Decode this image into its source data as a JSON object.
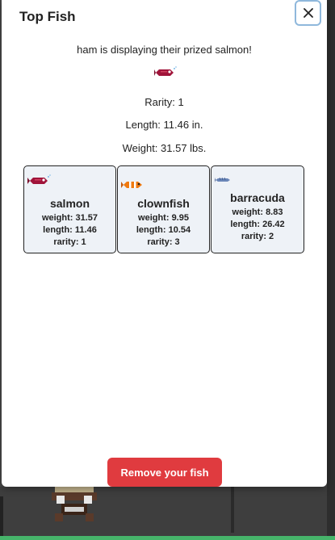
{
  "modal": {
    "title": "Top Fish",
    "close_label": "×",
    "message": "ham is displaying their prized salmon!",
    "featured": {
      "icon": "salmon-icon",
      "rarity_text": "Rarity: 1",
      "length_text": "Length: 11.46 in.",
      "weight_text": "Weight: 31.57 lbs."
    },
    "fish": [
      {
        "name": "salmon",
        "icon": "salmon-icon",
        "weight": "weight: 31.57",
        "length": "length: 11.46",
        "rarity": "rarity: 1"
      },
      {
        "name": "clownfish",
        "icon": "clownfish-icon",
        "weight": "weight: 9.95",
        "length": "length: 10.54",
        "rarity": "rarity: 3"
      },
      {
        "name": "barracuda",
        "icon": "barracuda-icon",
        "weight": "weight: 8.83",
        "length": "length: 26.42",
        "rarity": "rarity: 2"
      }
    ],
    "remove_label": "Remove your fish"
  },
  "colors": {
    "remove_button": "#e03b3f",
    "card_bg": "#eef2f7",
    "close_border": "#8fb8dc",
    "salmon": "#a0143a",
    "clownfish": "#f07a10",
    "barracuda": "#6a86b8"
  }
}
